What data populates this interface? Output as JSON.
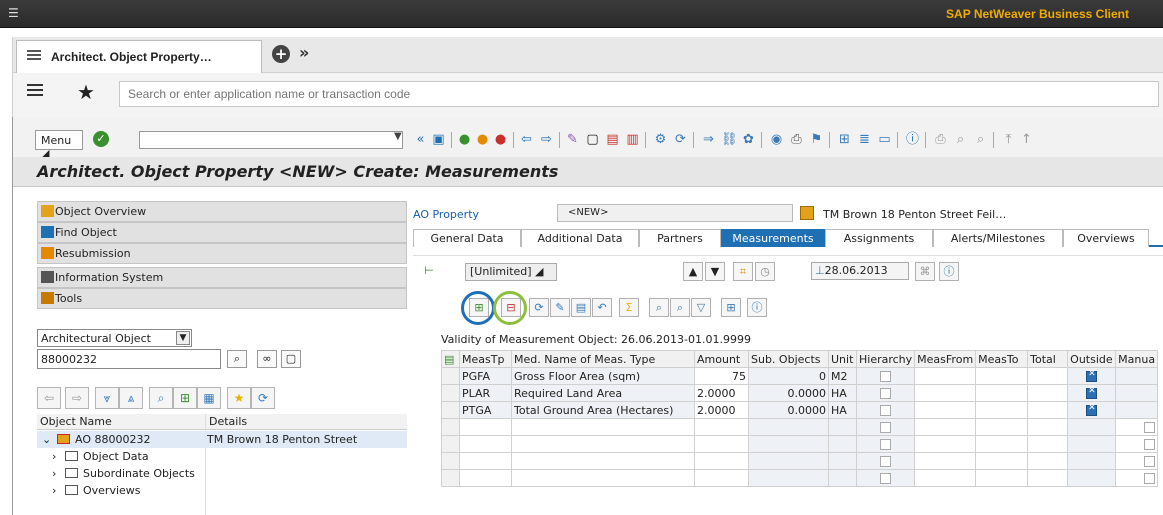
{
  "window": {
    "brand": "SAP NetWeaver Business Client"
  },
  "tabs": [
    {
      "label": "Architect. Object Property…"
    }
  ],
  "search": {
    "placeholder": "Search or enter application name or transaction code"
  },
  "toolbar": {
    "menu_label": "Menu"
  },
  "page": {
    "title": "Architect. Object Property <NEW> Create: Measurements"
  },
  "nav": {
    "items": [
      "Object Overview",
      "Find Object",
      "Resubmission",
      "Information System",
      "Tools"
    ],
    "object_type": "Architectural Object",
    "object_id": "88000232",
    "tree_headers": [
      "Object Name",
      "Details"
    ],
    "tree": [
      {
        "name": "AO 88000232",
        "details": "TM Brown 18 Penton Street"
      },
      {
        "name": "Object Data",
        "details": ""
      },
      {
        "name": "Subordinate Objects",
        "details": ""
      },
      {
        "name": "Overviews",
        "details": ""
      }
    ]
  },
  "detail": {
    "ao_property_label": "AO Property",
    "ao_property_value": "<NEW>",
    "ao_property_desc": "TM Brown 18 Penton Street Feil…",
    "tabs": [
      "General Data",
      "Additional Data",
      "Partners",
      "Measurements",
      "Assignments",
      "Alerts/Milestones",
      "Overviews"
    ],
    "active_tab": "Measurements",
    "limit_label": "[Unlimited]",
    "date": "28.06.2013",
    "validity": "Validity of Measurement Object: 26.06.2013-01.01.9999",
    "columns": [
      "MeasTp",
      "Med. Name of Meas. Type",
      "Amount",
      "Sub. Objects",
      "Unit",
      "Hierarchy",
      "MeasFrom",
      "MeasTo",
      "Total",
      "Outside",
      "Manua"
    ],
    "rows": [
      {
        "type": "PGFA",
        "name": "Gross Floor Area (sqm)",
        "amount": "75",
        "sub": "0",
        "unit": "M2"
      },
      {
        "type": "PLAR",
        "name": "Required Land Area",
        "amount": "2.0000",
        "sub": "0.0000",
        "unit": "HA"
      },
      {
        "type": "PTGA",
        "name": "Total Ground Area (Hectares)",
        "amount": "2.0000",
        "sub": "0.0000",
        "unit": "HA"
      }
    ]
  },
  "colors": {
    "accent": "#1f6fb3",
    "brand": "#f0ab00",
    "highlight_blue": "#1d6fb8",
    "highlight_green": "#8cbf3e"
  }
}
